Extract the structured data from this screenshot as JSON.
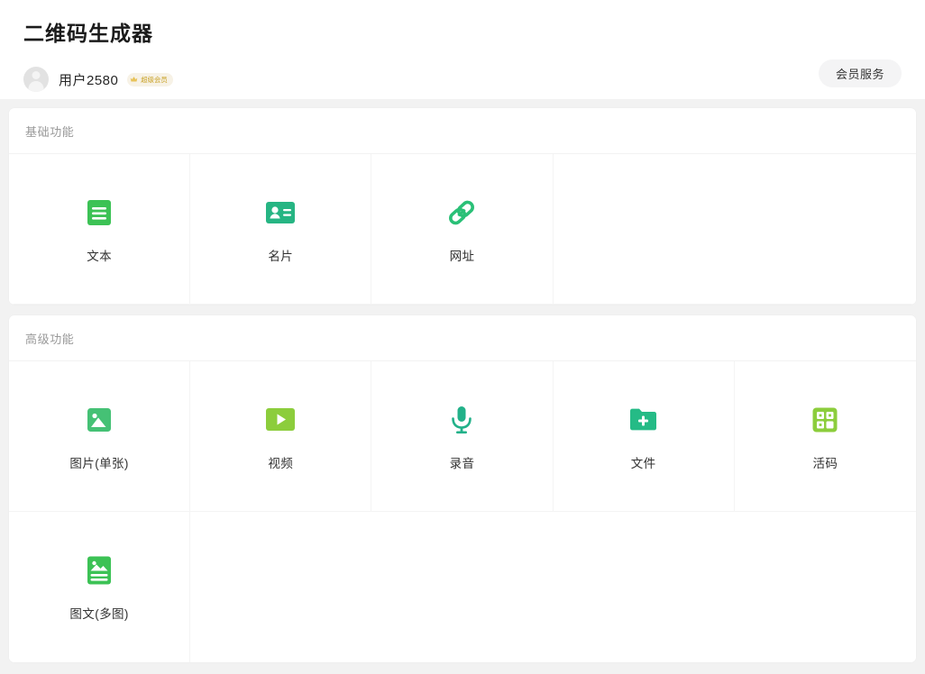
{
  "header": {
    "title": "二维码生成器",
    "user_name": "用户2580",
    "vip_badge": "超级会员",
    "vip_icon": "crown-icon",
    "avatar_icon": "default-avatar-icon",
    "member_service_label": "会员服务"
  },
  "colors": {
    "page_background": "#f2f2f2",
    "card_background": "#ffffff",
    "title_text": "#1b1b1b",
    "section_title": "#9a9a9a",
    "green_primary": "#3bc35a",
    "teal_primary": "#27b98c",
    "light_green": "#8ccd3c",
    "vip_gold": "#c9a227"
  },
  "sections": [
    {
      "id": "basic",
      "title": "基础功能",
      "items": [
        {
          "label": "文本",
          "icon": "text-lines-icon",
          "icon_color": "#3cc255"
        },
        {
          "label": "名片",
          "icon": "business-card-icon",
          "icon_color": "#26b583"
        },
        {
          "label": "网址",
          "icon": "link-chain-icon",
          "icon_color": "#2ac077"
        },
        {
          "label": "",
          "icon": "",
          "icon_color": ""
        },
        {
          "label": "",
          "icon": "",
          "icon_color": ""
        }
      ]
    },
    {
      "id": "advanced",
      "title": "高级功能",
      "items": [
        {
          "label": "图片(单张)",
          "icon": "image-single-icon",
          "icon_color": "#45c175"
        },
        {
          "label": "视频",
          "icon": "video-play-icon",
          "icon_color": "#8ccd3c"
        },
        {
          "label": "录音",
          "icon": "microphone-icon",
          "icon_color": "#22b189"
        },
        {
          "label": "文件",
          "icon": "folder-plus-icon",
          "icon_color": "#25bb86"
        },
        {
          "label": "活码",
          "icon": "qr-grid-icon",
          "icon_color": "#8ccd3c"
        },
        {
          "label": "图文(多图)",
          "icon": "image-multi-icon",
          "icon_color": "#3cc255"
        },
        {
          "label": "",
          "icon": "",
          "icon_color": ""
        },
        {
          "label": "",
          "icon": "",
          "icon_color": ""
        },
        {
          "label": "",
          "icon": "",
          "icon_color": ""
        },
        {
          "label": "",
          "icon": "",
          "icon_color": ""
        }
      ]
    }
  ]
}
